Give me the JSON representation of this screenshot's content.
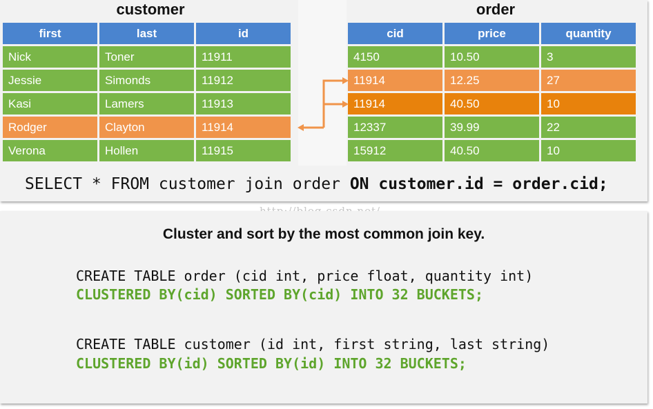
{
  "customer_table": {
    "title": "customer",
    "columns": [
      "first",
      "last",
      "id"
    ],
    "rows": [
      [
        "Nick",
        "Toner",
        "11911"
      ],
      [
        "Jessie",
        "Simonds",
        "11912"
      ],
      [
        "Kasi",
        "Lamers",
        "11913"
      ],
      [
        "Rodger",
        "Clayton",
        "11914"
      ],
      [
        "Verona",
        "Hollen",
        "11915"
      ]
    ],
    "highlighted_row_index": 3
  },
  "order_table": {
    "title": "order",
    "columns": [
      "cid",
      "price",
      "quantity"
    ],
    "rows": [
      [
        "4150",
        "10.50",
        "3"
      ],
      [
        "11914",
        "12.25",
        "27"
      ],
      [
        "11914",
        "40.50",
        "10"
      ],
      [
        "12337",
        "39.99",
        "22"
      ],
      [
        "15912",
        "40.50",
        "10"
      ]
    ],
    "highlighted_row_indices": [
      1,
      2
    ]
  },
  "colors": {
    "header": "#4a84cf",
    "row": "#7ab648",
    "highlight_light": "#f0944a",
    "highlight_dark": "#e8820c",
    "arrow": "#f0944a",
    "code_green": "#5ea52c"
  },
  "query": {
    "plain": "SELECT * FROM customer join order ",
    "bold": "ON customer.id = order.cid;"
  },
  "watermark": "http://blog.csdn.net/",
  "heading": "Cluster and sort by the most common join key.",
  "code": {
    "order_create": "CREATE TABLE order (cid int, price float, quantity int)",
    "order_cluster": "CLUSTERED BY(cid) SORTED BY(cid) INTO 32 BUCKETS;",
    "customer_create": "CREATE TABLE customer (id int, first string, last string)",
    "customer_cluster": "CLUSTERED BY(id) SORTED BY(id) INTO 32 BUCKETS;"
  }
}
